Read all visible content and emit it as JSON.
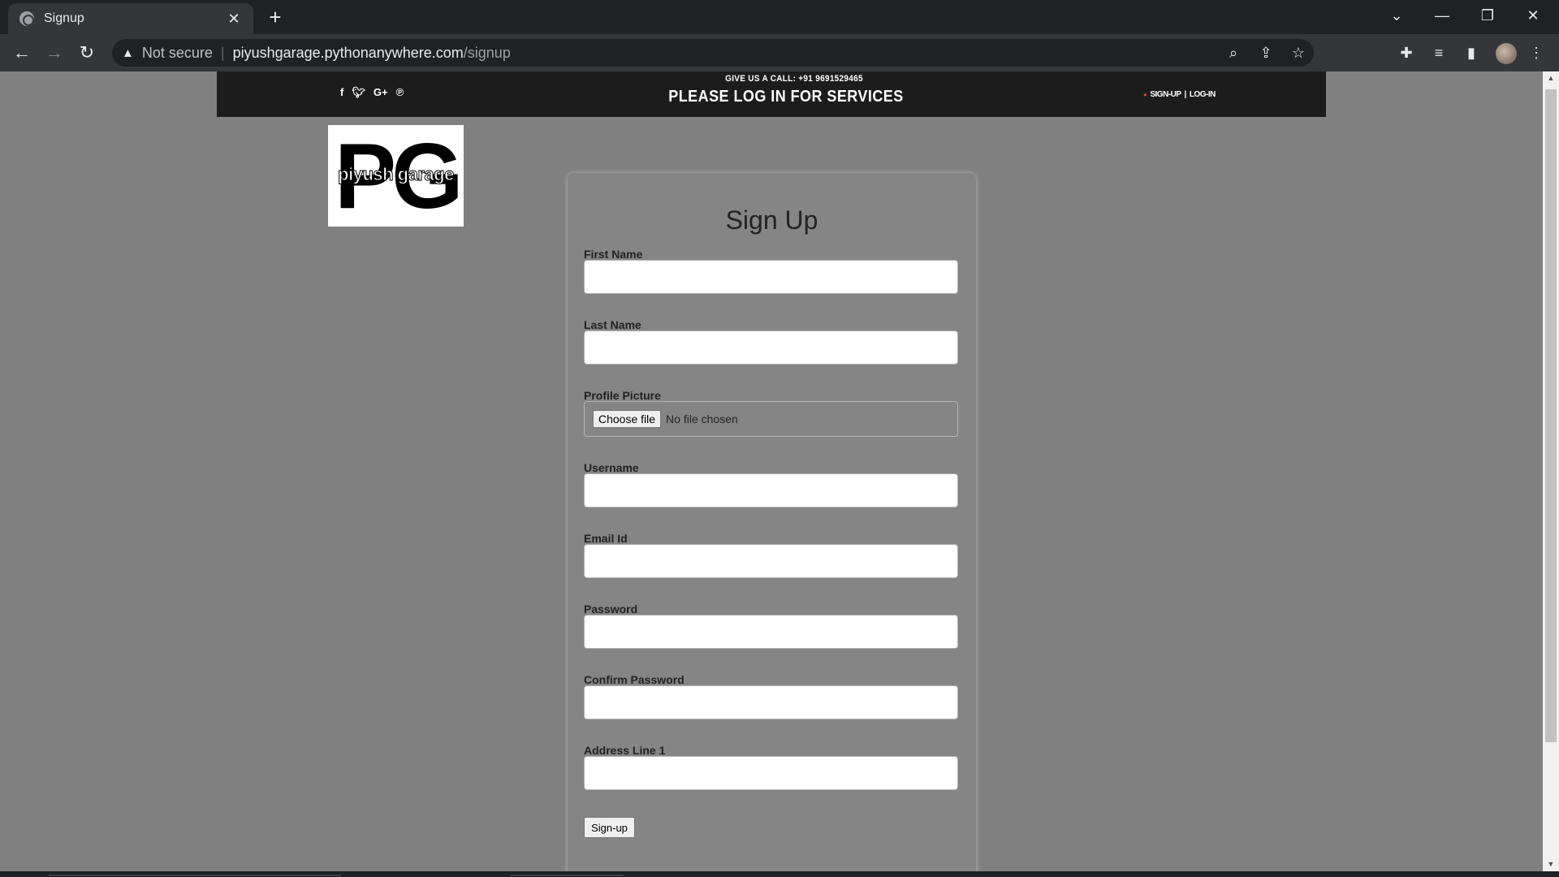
{
  "browser": {
    "tab_title": "Signup",
    "new_tab": "+",
    "security_label": "Not secure",
    "url_host": "piyushgarage.pythonanywhere.com",
    "url_path": "/signup"
  },
  "site_header": {
    "call_text": "GIVE US A CALL: +91 9691529465",
    "headline": "PLEASE LOG IN FOR SERVICES",
    "signup_link": "SIGN-UP",
    "login_link": "LOG-IN",
    "link_divider": "|",
    "social_icons": [
      "facebook-icon",
      "twitter-icon",
      "google-plus-icon",
      "pinterest-icon"
    ]
  },
  "logo": {
    "letters": "PG",
    "text": "piyush garage"
  },
  "form": {
    "title": "Sign Up",
    "fields": [
      {
        "label": "First Name",
        "value": ""
      },
      {
        "label": "Last Name",
        "value": ""
      },
      {
        "label": "Profile Picture",
        "choose_label": "Choose file",
        "status": "No file chosen"
      },
      {
        "label": "Username",
        "value": ""
      },
      {
        "label": "Email Id",
        "value": ""
      },
      {
        "label": "Password",
        "value": ""
      },
      {
        "label": "Confirm Password",
        "value": ""
      },
      {
        "label": "Address Line 1",
        "value": ""
      }
    ],
    "submit_label": "Sign-up"
  },
  "colors": {
    "page_bg": "#808080",
    "header_bg": "#1c1c1c",
    "card_bg": "#858585"
  }
}
